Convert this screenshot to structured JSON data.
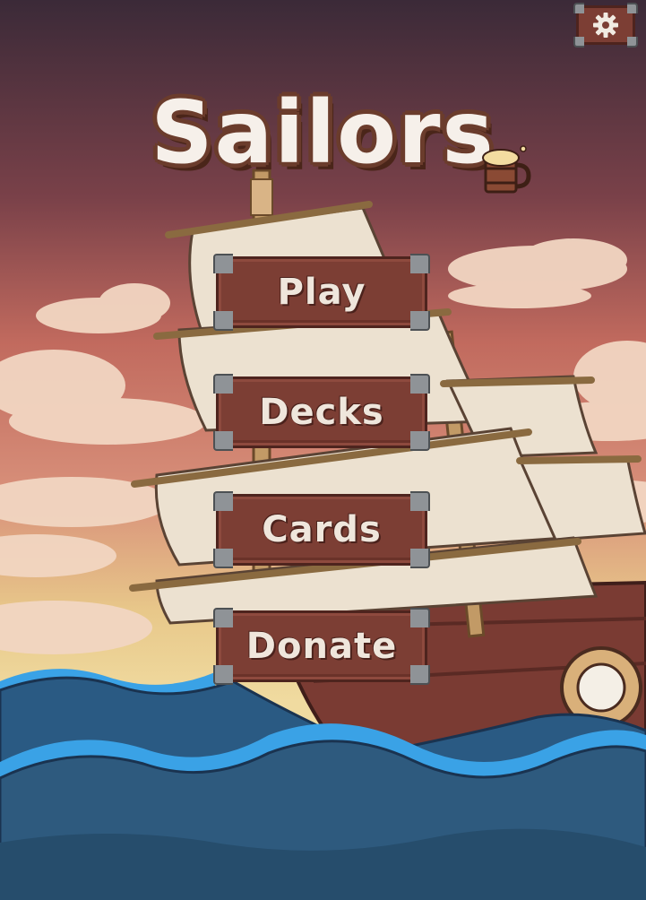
{
  "title": "Sailors",
  "menu": {
    "play_label": "Play",
    "decks_label": "Decks",
    "cards_label": "Cards",
    "donate_label": "Donate"
  },
  "icons": {
    "settings": "gear-icon",
    "logo_accent": "beer-mug-icon"
  },
  "colors": {
    "button_wood": "#7c3e34",
    "button_text": "#efe6dc",
    "metal_corner": "#8f9397",
    "sky_top": "#3b2a38",
    "sky_mid": "#c16a5e",
    "sky_low": "#e8c88a",
    "sea": "#2e5a7e",
    "wave_foam": "#3aa2e6"
  }
}
